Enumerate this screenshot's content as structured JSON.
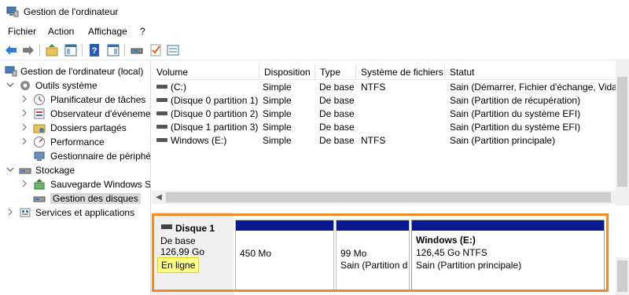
{
  "window": {
    "title": "Gestion de l'ordinateur"
  },
  "menu": {
    "items": [
      "Fichier",
      "Action",
      "Affichage",
      "?"
    ]
  },
  "toolbar": {
    "buttons": [
      "back-arrow-icon",
      "forward-arrow-icon",
      "up-folder-icon",
      "console-tree-icon",
      "help-icon",
      "properties-icon",
      "disk-connect-icon",
      "check-icon",
      "list-view-icon"
    ]
  },
  "tree": {
    "items": [
      {
        "label": "Gestion de l'ordinateur (local)",
        "icon": "computer-management-icon"
      },
      {
        "label": "Outils système",
        "icon": "tools-icon"
      },
      {
        "label": "Planificateur de tâches",
        "icon": "clock-icon"
      },
      {
        "label": "Observateur d'événeme",
        "icon": "event-viewer-icon"
      },
      {
        "label": "Dossiers partagés",
        "icon": "shared-folder-icon"
      },
      {
        "label": "Performance",
        "icon": "performance-icon"
      },
      {
        "label": "Gestionnaire de périphé",
        "icon": "device-manager-icon"
      },
      {
        "label": "Stockage",
        "icon": "storage-icon"
      },
      {
        "label": "Sauvegarde Windows Se",
        "icon": "backup-icon"
      },
      {
        "label": "Gestion des disques",
        "icon": "disk-management-icon"
      },
      {
        "label": "Services et applications",
        "icon": "services-icon"
      }
    ]
  },
  "volumes": {
    "columns": [
      "Volume",
      "Disposition",
      "Type",
      "Système de fichiers",
      "Statut"
    ],
    "rows": [
      {
        "volume": "(C:)",
        "layout": "Simple",
        "type": "De base",
        "fs": "NTFS",
        "status": "Sain (Démarrer, Fichier d'échange, Vidage"
      },
      {
        "volume": "(Disque 0 partition 1)",
        "layout": "Simple",
        "type": "De base",
        "fs": "",
        "status": "Sain (Partition de récupération)"
      },
      {
        "volume": "(Disque 0 partition 2)",
        "layout": "Simple",
        "type": "De base",
        "fs": "",
        "status": "Sain (Partition du système EFI)"
      },
      {
        "volume": "(Disque 1 partition 3)",
        "layout": "Simple",
        "type": "De base",
        "fs": "",
        "status": "Sain (Partition du système EFI)"
      },
      {
        "volume": "Windows (E:)",
        "layout": "Simple",
        "type": "De base",
        "fs": "NTFS",
        "status": "Sain (Partition principale)"
      }
    ]
  },
  "disk": {
    "name": "Disque 1",
    "kind": "De base",
    "size": "126,99 Go",
    "state": "En ligne",
    "partitions": [
      {
        "line1": "450 Mo",
        "line2": ""
      },
      {
        "line1": "99 Mo",
        "line2": "Sain (Partition d"
      },
      {
        "title": "Windows  (E:)",
        "line1": "126,45 Go NTFS",
        "line2": "Sain (Partition principale)"
      }
    ]
  },
  "colors": {
    "partition_bar": "#0a1a8c",
    "highlight": "#f08a24",
    "online_badge": "#ffff8a"
  }
}
